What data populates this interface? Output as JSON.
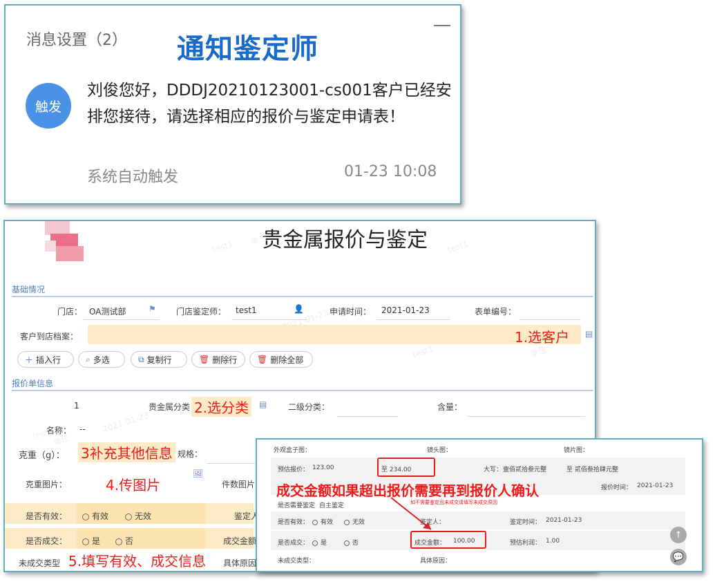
{
  "notification": {
    "title": "消息设置（2）",
    "annotation": "通知鉴定师",
    "avatar_text": "触发",
    "message": "刘俊您好，DDDJ20210123001-cs001客户已经安排您接待，请选择相应的报价与鉴定申请表！",
    "source": "系统自动触发",
    "time": "01-23 10:08"
  },
  "form": {
    "title": "贵金属报价与鉴定",
    "watermarks": [
      "test1",
      "单位",
      "test1",
      "2021-01-23",
      "test1",
      "单位",
      "2021-01-23",
      "test1",
      "单位"
    ],
    "section_basic": "基础情况",
    "store_label": "门店：",
    "store_value": "OA测试部",
    "appraiser_label": "门店鉴定师：",
    "appraiser_value": "test1",
    "apply_time_label": "申请时间：",
    "apply_time_value": "2021-01-23",
    "form_no_label": "表单编号：",
    "customer_label": "客户到店档案：",
    "buttons": {
      "insert": "插入行",
      "multi": "多选",
      "copy": "复制行",
      "delete": "删除行",
      "delete_all": "删除全部"
    },
    "section_quote": "报价单信息",
    "row_no": "1",
    "category_label": "贵金属分类：",
    "sub_category_label": "二级分类：",
    "content_label": "含量：",
    "name_label": "名称：",
    "name_value": "--",
    "weight_label": "克重（g）：",
    "spec_label": "规格：",
    "weight_img_label": "克重图片：",
    "piece_img_label": "件数图片",
    "valid_label": "是否有效：",
    "valid_yes": "有效",
    "valid_no": "无效",
    "appraiser2_label": "鉴定人",
    "deal_label": "是否成交：",
    "deal_yes": "是",
    "deal_no": "否",
    "deal_amount_label": "成交金额",
    "no_deal_type_label": "未成交类型",
    "reason_label": "具体原因"
  },
  "annotations": {
    "step1": "1.选客户",
    "step2": "2.选分类",
    "step3": "3补充其他信息",
    "step4": "4.传图片",
    "step5": "5.填写有效、成交信息",
    "overlay_note": "成交金额如果超出报价需要再到报价人确认"
  },
  "overlay": {
    "outer_img": "外观盒子图：",
    "label_img": "镜头图：",
    "lens_img": "镜片图：",
    "quote_label": "预估报价：",
    "quote_value": "123.00",
    "to_value": "至 234.00",
    "upper_label": "大写：",
    "upper_value": "壹佰贰拾叁元整",
    "upper_to": "至 贰佰叁拾肆元整",
    "quote_time_label": "报价时间：",
    "quote_time_value": "2021-01-23",
    "need_appraise_label": "是否需要鉴定",
    "self_appraise": "自主鉴定",
    "small_note": "如不需要鉴定且未成交请填写未成交原因",
    "valid_label": "是否有效：",
    "valid_yes": "有效",
    "valid_no": "无效",
    "appraiser_label": "鉴定人：",
    "appraise_time_label": "鉴定时间：",
    "appraise_time_value": "2021-01-23",
    "deal_label": "是否成交：",
    "deal_yes": "是",
    "deal_no": "否",
    "amount_label": "成交金额：",
    "amount_value": "100.00",
    "profit_label": "预估利润：",
    "profit_value": "1.00",
    "no_deal_label": "未成交类型：",
    "reason_label": "具体原因："
  },
  "colors": {
    "accent_border": "#62aebe",
    "annotation_red": "#f01a1a",
    "highlight_yellow": "#fcebc6",
    "title_blue": "#1a6ac9",
    "avatar_blue": "#4a92e6"
  }
}
